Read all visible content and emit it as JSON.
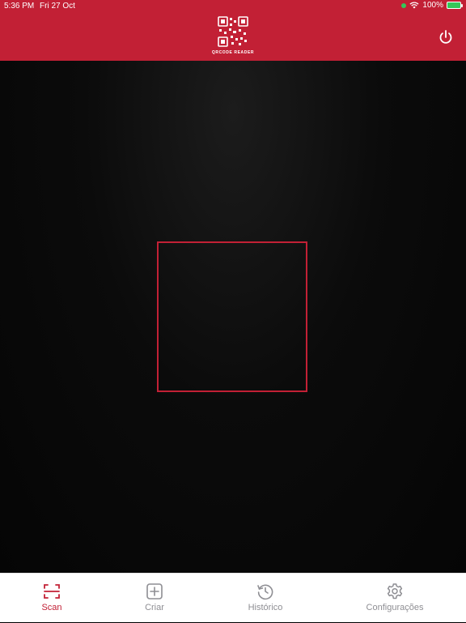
{
  "status_bar": {
    "time": "5:36 PM",
    "date": "Fri 27 Oct",
    "battery": "100%"
  },
  "header": {
    "logo_caption": "QRCODE READER"
  },
  "tabs": [
    {
      "label": "Scan",
      "icon": "scan-icon",
      "active": true
    },
    {
      "label": "Criar",
      "icon": "plus-square-icon",
      "active": false
    },
    {
      "label": "Histórico",
      "icon": "history-icon",
      "active": false
    },
    {
      "label": "Configurações",
      "icon": "gear-icon",
      "active": false
    }
  ],
  "colors": {
    "accent": "#c22035",
    "tab_inactive": "#8e8e93"
  }
}
